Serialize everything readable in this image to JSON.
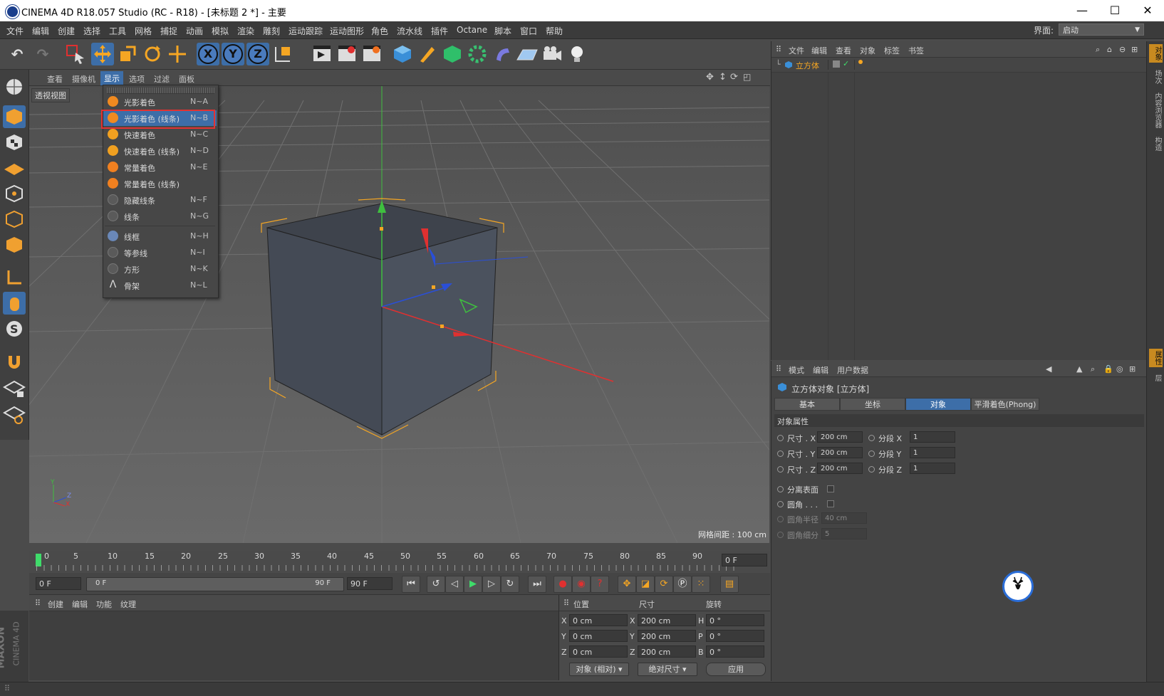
{
  "window": {
    "title": "CINEMA 4D R18.057 Studio (RC - R18) - [未标题 2 *] - 主要",
    "minimize": "—",
    "maximize": "☐",
    "close": "✕"
  },
  "menubar": {
    "items": [
      "文件",
      "编辑",
      "创建",
      "选择",
      "工具",
      "网格",
      "捕捉",
      "动画",
      "模拟",
      "渲染",
      "雕刻",
      "运动跟踪",
      "运动图形",
      "角色",
      "流水线",
      "插件",
      "Octane",
      "脚本",
      "窗口",
      "帮助"
    ],
    "layout_label": "界面:",
    "layout_value": "启动"
  },
  "viewport": {
    "menu": [
      "查看",
      "摄像机",
      "显示",
      "选项",
      "过滤",
      "面板"
    ],
    "active_menu": "显示",
    "camera_label": "透视视图",
    "grid_spacing": "网格间距 : 100 cm",
    "axis_y": "Y",
    "axis_z": "Z",
    "axis_x": "X"
  },
  "display_menu": {
    "items": [
      {
        "label": "光影着色",
        "key": "N~A",
        "icon": "gouraud-shading-icon",
        "color": "#f08a20"
      },
      {
        "label": "光影着色 (线条)",
        "key": "N~B",
        "icon": "gouraud-lines-icon",
        "color": "#f08a20"
      },
      {
        "label": "快速着色",
        "key": "N~C",
        "icon": "quick-shading-icon",
        "color": "#f0a020"
      },
      {
        "label": "快速着色 (线条)",
        "key": "N~D",
        "icon": "quick-lines-icon",
        "color": "#f0a020"
      },
      {
        "label": "常量着色",
        "key": "N~E",
        "icon": "constant-shading-icon",
        "color": "#f08020"
      },
      {
        "label": "常量着色 (线条)",
        "key": "",
        "icon": "constant-lines-icon",
        "color": "#f08020"
      },
      {
        "label": "隐藏线条",
        "key": "N~F",
        "icon": "hidden-line-icon",
        "color": "#5a5a5a"
      },
      {
        "label": "线条",
        "key": "N~G",
        "icon": "lines-icon",
        "color": "#5a5a5a"
      },
      {
        "label": "线框",
        "key": "N~H",
        "icon": "wireframe-icon",
        "color": "#6a88b8"
      },
      {
        "label": "等参线",
        "key": "N~I",
        "icon": "isoparm-icon",
        "color": "#5a5a5a"
      },
      {
        "label": "方形",
        "key": "N~K",
        "icon": "box-icon",
        "color": "#5a5a5a"
      },
      {
        "label": "骨架",
        "key": "N~L",
        "icon": "skeleton-icon",
        "color": "#5a5a5a"
      }
    ],
    "highlighted_index": 1
  },
  "timeline": {
    "ticks": [
      "0",
      "5",
      "10",
      "15",
      "20",
      "25",
      "30",
      "35",
      "40",
      "45",
      "50",
      "55",
      "60",
      "65",
      "70",
      "75",
      "80",
      "85",
      "90"
    ],
    "current_frame": "0 F"
  },
  "playbar": {
    "start": "0 F",
    "range_start": "0 F",
    "range_end": "90 F",
    "end": "90 F"
  },
  "material_panel": {
    "menu": [
      "创建",
      "编辑",
      "功能",
      "纹理"
    ]
  },
  "coord_panel": {
    "headers": [
      "位置",
      "尺寸",
      "旋转"
    ],
    "rows": [
      {
        "a": "X",
        "pos": "0 cm",
        "b": "X",
        "size": "200 cm",
        "c": "H",
        "rot": "0 °"
      },
      {
        "a": "Y",
        "pos": "0 cm",
        "b": "Y",
        "size": "200 cm",
        "c": "P",
        "rot": "0 °"
      },
      {
        "a": "Z",
        "pos": "0 cm",
        "b": "Z",
        "size": "200 cm",
        "c": "B",
        "rot": "0 °"
      }
    ],
    "mode": "对象 (相对)",
    "size_mode": "绝对尺寸",
    "apply": "应用"
  },
  "object_manager": {
    "menu": [
      "文件",
      "编辑",
      "查看",
      "对象",
      "标签",
      "书签"
    ],
    "objects": [
      {
        "name": "立方体"
      }
    ]
  },
  "attribute_manager": {
    "menu": [
      "模式",
      "编辑",
      "用户数据"
    ],
    "title": "立方体对象 [立方体]",
    "tabs": [
      "基本",
      "坐标",
      "对象",
      "平滑着色(Phong)"
    ],
    "active_tab": "对象",
    "section": "对象属性",
    "size": [
      {
        "label": "尺寸 . X",
        "value": "200 cm",
        "seg_label": "分段 X",
        "seg": "1"
      },
      {
        "label": "尺寸 . Y",
        "value": "200 cm",
        "seg_label": "分段 Y",
        "seg": "1"
      },
      {
        "label": "尺寸 . Z",
        "value": "200 cm",
        "seg_label": "分段 Z",
        "seg": "1"
      }
    ],
    "separate_surfaces": "分离表面",
    "fillet": "圆角 . . .",
    "fillet_radius_label": "圆角半径",
    "fillet_radius": "40 cm",
    "fillet_sub_label": "圆角细分",
    "fillet_sub": "5"
  },
  "right_tabs": [
    "对象",
    "场次",
    "内容浏览器",
    "构造"
  ],
  "right_tabs_lower": [
    "属性",
    "层"
  ],
  "brand": {
    "maxon": "MAXON",
    "c4d": "CINEMA 4D"
  }
}
